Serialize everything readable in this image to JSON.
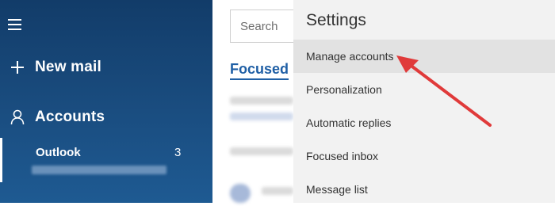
{
  "nav": {
    "new_mail_label": "New mail",
    "accounts_label": "Accounts",
    "account_name": "Outlook",
    "account_count": "3"
  },
  "list": {
    "search_placeholder": "Search",
    "focused_tab": "Focused"
  },
  "settings": {
    "title": "Settings",
    "items": [
      {
        "label": "Manage accounts"
      },
      {
        "label": "Personalization"
      },
      {
        "label": "Automatic replies"
      },
      {
        "label": "Focused inbox"
      },
      {
        "label": "Message list"
      }
    ]
  },
  "colors": {
    "nav_bg": "#1a4d80",
    "accent": "#1f5fa5",
    "arrow": "#e03a3a"
  }
}
